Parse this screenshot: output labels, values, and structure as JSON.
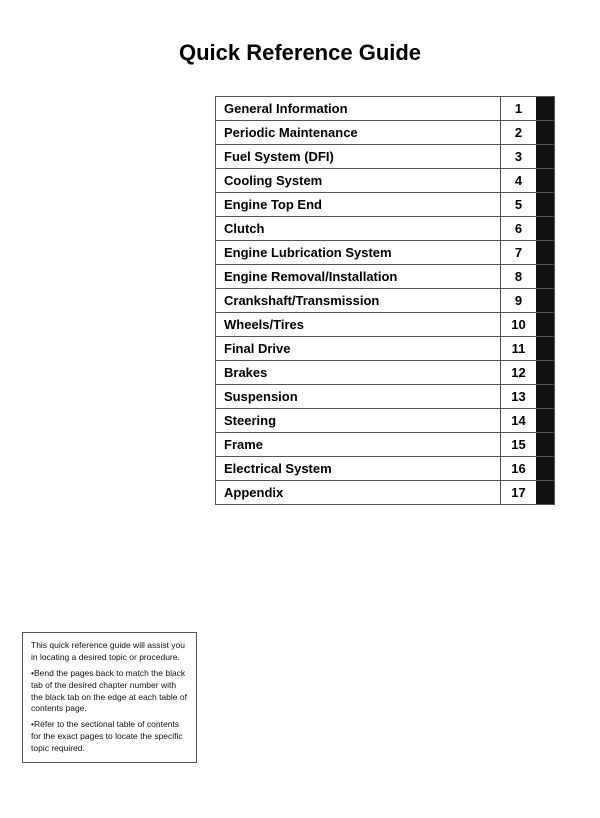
{
  "title": "Quick Reference Guide",
  "toc": [
    {
      "label": "General Information",
      "number": "1"
    },
    {
      "label": "Periodic Maintenance",
      "number": "2"
    },
    {
      "label": "Fuel System (DFI)",
      "number": "3"
    },
    {
      "label": "Cooling System",
      "number": "4"
    },
    {
      "label": "Engine Top End",
      "number": "5"
    },
    {
      "label": "Clutch",
      "number": "6"
    },
    {
      "label": "Engine Lubrication System",
      "number": "7"
    },
    {
      "label": "Engine Removal/Installation",
      "number": "8"
    },
    {
      "label": "Crankshaft/Transmission",
      "number": "9"
    },
    {
      "label": "Wheels/Tires",
      "number": "10"
    },
    {
      "label": "Final Drive",
      "number": "11"
    },
    {
      "label": "Brakes",
      "number": "12"
    },
    {
      "label": "Suspension",
      "number": "13"
    },
    {
      "label": "Steering",
      "number": "14"
    },
    {
      "label": "Frame",
      "number": "15"
    },
    {
      "label": "Electrical System",
      "number": "16"
    },
    {
      "label": "Appendix",
      "number": "17"
    }
  ],
  "note": {
    "line1": "This quick reference guide will assist you in locating a desired topic or procedure.",
    "line2": "•Bend the pages back to match the black tab of the desired chapter number with the black tab on the edge at each table of contents page.",
    "line3": "•Refer to the sectional table of contents for the exact pages to locate the specific topic required."
  }
}
